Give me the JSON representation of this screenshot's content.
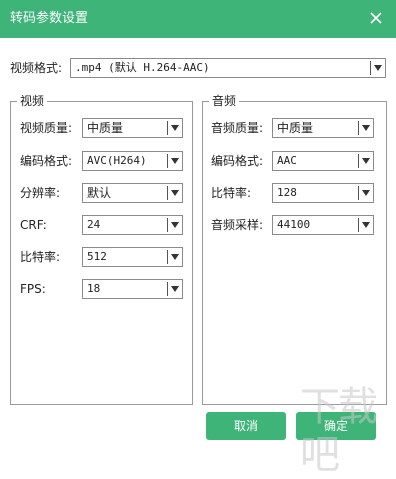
{
  "window": {
    "title": "转码参数设置"
  },
  "format": {
    "label": "视频格式:",
    "value": ".mp4 (默认 H.264-AAC)"
  },
  "video": {
    "group_title": "视频",
    "quality": {
      "label": "视频质量:",
      "value": "中质量"
    },
    "codec": {
      "label": "编码格式:",
      "value": "AVC(H264)"
    },
    "resolution": {
      "label": "分辨率:",
      "value": "默认"
    },
    "crf": {
      "label": "CRF:",
      "value": "24"
    },
    "bitrate": {
      "label": "比特率:",
      "value": "512"
    },
    "fps": {
      "label": "FPS:",
      "value": "18"
    }
  },
  "audio": {
    "group_title": "音频",
    "quality": {
      "label": "音频质量:",
      "value": "中质量"
    },
    "codec": {
      "label": "编码格式:",
      "value": "AAC"
    },
    "bitrate": {
      "label": "比特率:",
      "value": "128"
    },
    "samplerate": {
      "label": "音频采样:",
      "value": "44100"
    }
  },
  "buttons": {
    "cancel": "取消",
    "ok": "确定"
  },
  "colors": {
    "accent": "#3eb478"
  },
  "watermark": {
    "text": "下载吧"
  }
}
